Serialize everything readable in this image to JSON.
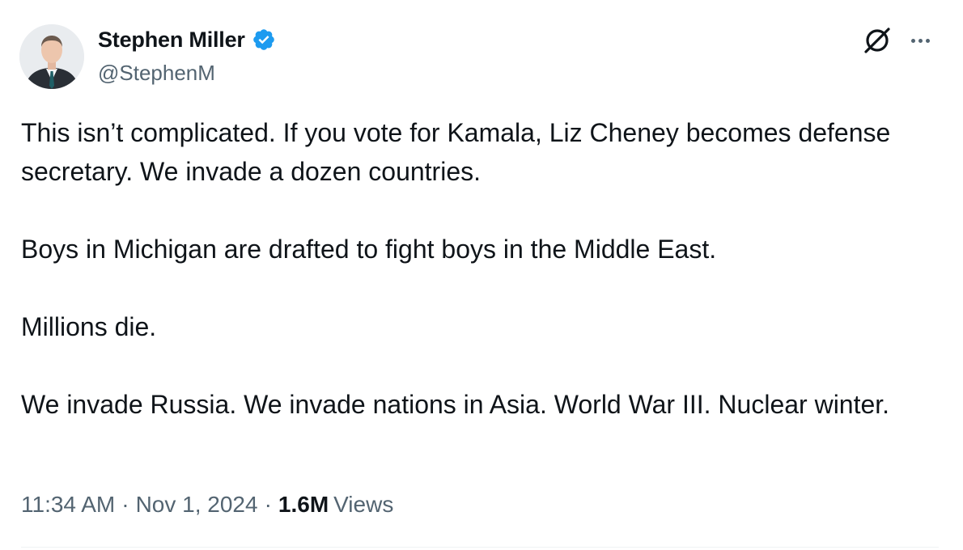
{
  "author": {
    "display_name": "Stephen Miller",
    "handle": "@StephenM",
    "verified": true,
    "verified_color": "#1d9bf0",
    "avatar_icon": "profile-photo"
  },
  "actions": {
    "grok_icon": "grok-icon",
    "more_icon": "more-options-icon"
  },
  "tweet": {
    "paragraphs": [
      "This isn’t complicated. If you vote for Kamala, Liz Cheney becomes defense secretary. We invade a dozen countries.",
      "Boys in Michigan are drafted to fight boys in the Middle East.",
      "Millions die.",
      "We invade Russia. We invade nations in Asia. World War III. Nuclear winter."
    ]
  },
  "meta": {
    "time": "11:34 AM",
    "separator": "·",
    "date": "Nov 1, 2024",
    "views_count": "1.6M",
    "views_label": "Views"
  },
  "colors": {
    "text_primary": "#0f1419",
    "text_secondary": "#536471",
    "divider": "#eff3f4"
  }
}
